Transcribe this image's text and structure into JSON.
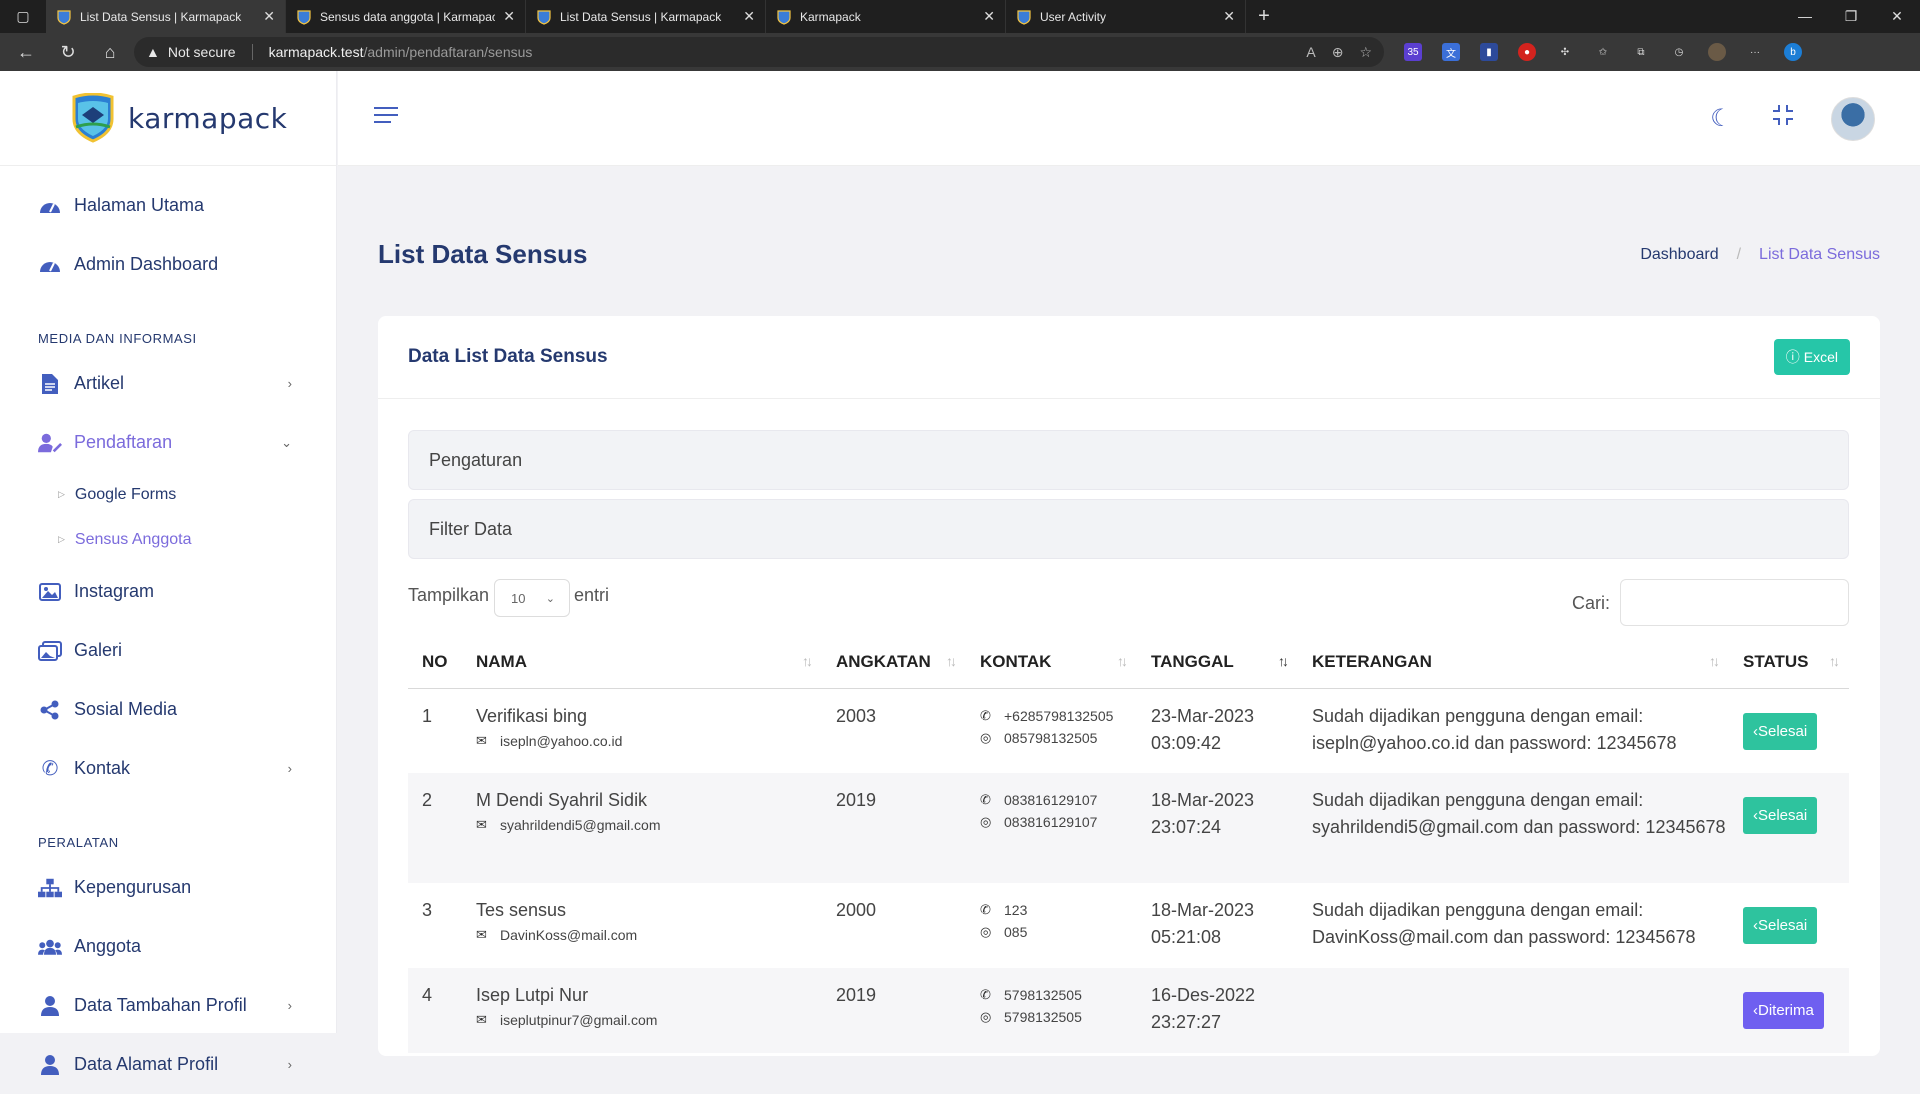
{
  "browser": {
    "tabs": [
      {
        "title": "List Data Sensus | Karmapack",
        "active": true
      },
      {
        "title": "Sensus data anggota | Karmapack",
        "active": false
      },
      {
        "title": "List Data Sensus | Karmapack",
        "active": false
      },
      {
        "title": "Karmapack",
        "active": false
      },
      {
        "title": "User Activity",
        "active": false
      }
    ],
    "security": "Not secure",
    "url_host": "karmapack.test",
    "url_path": "/admin/pendaftaran/sensus",
    "ext_badge": "35"
  },
  "brand": {
    "name": "karmapack"
  },
  "sidebar": {
    "items_top": [
      {
        "label": "Halaman Utama"
      },
      {
        "label": "Admin Dashboard"
      }
    ],
    "section_media": "MEDIA DAN INFORMASI",
    "artikel": "Artikel",
    "pendaftaran": "Pendaftaran",
    "sub": [
      {
        "label": "Google Forms"
      },
      {
        "label": "Sensus Anggota"
      }
    ],
    "instagram": "Instagram",
    "galeri": "Galeri",
    "sosial": "Sosial Media",
    "kontak": "Kontak",
    "section_tools": "PERALATAN",
    "kepengurusan": "Kepengurusan",
    "anggota": "Anggota",
    "data_tambahan": "Data Tambahan Profil",
    "data_alamat": "Data Alamat Profil"
  },
  "page": {
    "title": "List Data Sensus",
    "breadcrumb": [
      "Dashboard",
      "List Data Sensus"
    ]
  },
  "card": {
    "title": "Data List Data Sensus",
    "excel_label": "Excel",
    "panel_settings": "Pengaturan",
    "panel_filter": "Filter Data",
    "show_label": "Tampilkan",
    "show_value": "10",
    "entries_label": "entri",
    "search_label": "Cari:",
    "search_value": ""
  },
  "table": {
    "headers": [
      "NO",
      "NAMA",
      "ANGKATAN",
      "KONTAK",
      "TANGGAL",
      "KETERANGAN",
      "STATUS"
    ],
    "rows": [
      {
        "no": "1",
        "nama": "Verifikasi bing",
        "email": "isepln@yahoo.co.id",
        "angkatan": "2003",
        "phone": "+6285798132505",
        "wa": "085798132505",
        "tanggal": "23-Mar-2023",
        "jam": "03:09:42",
        "keterangan": "Sudah dijadikan pengguna dengan email: isepln@yahoo.co.id dan password: 12345678",
        "status": "Selesai"
      },
      {
        "no": "2",
        "nama": "M Dendi Syahril Sidik",
        "email": "syahrildendi5@gmail.com",
        "angkatan": "2019",
        "phone": "083816129107",
        "wa": "083816129107",
        "tanggal": "18-Mar-2023",
        "jam": "23:07:24",
        "keterangan": "Sudah dijadikan pengguna dengan email: syahrildendi5@gmail.com dan password: 12345678",
        "status": "Selesai"
      },
      {
        "no": "3",
        "nama": "Tes sensus",
        "email": "DavinKoss@mail.com",
        "angkatan": "2000",
        "phone": "123",
        "wa": "085",
        "tanggal": "18-Mar-2023",
        "jam": "05:21:08",
        "keterangan": "Sudah dijadikan pengguna dengan email: DavinKoss@mail.com dan password: 12345678",
        "status": "Selesai"
      },
      {
        "no": "4",
        "nama": "Isep Lutpi Nur",
        "email": "iseplutpinur7@gmail.com",
        "angkatan": "2019",
        "phone": "5798132505",
        "wa": "5798132505",
        "tanggal": "16-Des-2022",
        "jam": "23:27:27",
        "keterangan": "",
        "status": "Diterima"
      }
    ]
  },
  "colors": {
    "accent": "#435ebe",
    "active": "#7b6bdc",
    "success": "#2ec39e",
    "primary_badge": "#6f5ff0"
  }
}
